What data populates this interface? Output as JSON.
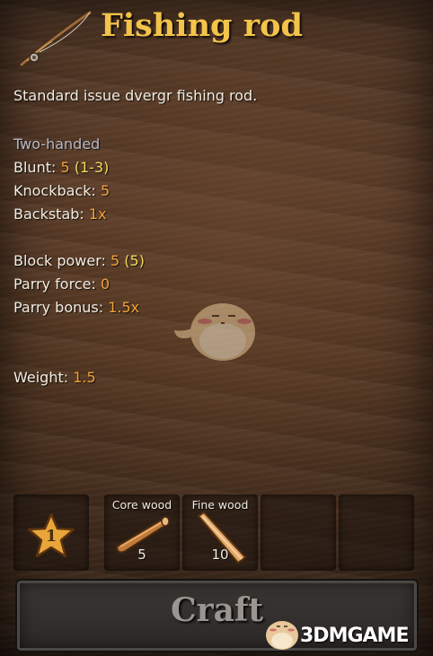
{
  "item": {
    "title": "Fishing rod",
    "description": "Standard issue dvergr fishing rod.",
    "icon": "fishing-rod-icon"
  },
  "stats": {
    "handedness": "Two-handed",
    "blunt": {
      "label": "Blunt:",
      "value": "5",
      "range": "(1-3)"
    },
    "knockback": {
      "label": "Knockback:",
      "value": "5"
    },
    "backstab": {
      "label": "Backstab:",
      "value": "1x"
    },
    "block_power": {
      "label": "Block power:",
      "value": "5",
      "bonus": "(5)"
    },
    "parry_force": {
      "label": "Parry force:",
      "value": "0"
    },
    "parry_bonus": {
      "label": "Parry bonus:",
      "value": "1.5x"
    },
    "weight": {
      "label": "Weight:",
      "value": "1.5"
    }
  },
  "recipe": {
    "quality_level": "1",
    "ingredients": [
      {
        "name": "Core wood",
        "count": "5",
        "icon": "core-wood-icon"
      },
      {
        "name": "Fine wood",
        "count": "10",
        "icon": "fine-wood-icon"
      }
    ]
  },
  "actions": {
    "craft_label": "Craft"
  },
  "watermark": {
    "text": "3DMGAME"
  },
  "colors": {
    "title": "#f3c34a",
    "value": "#f1a23a",
    "bonus": "#f0dc5a",
    "muted": "#b8b8c4"
  }
}
